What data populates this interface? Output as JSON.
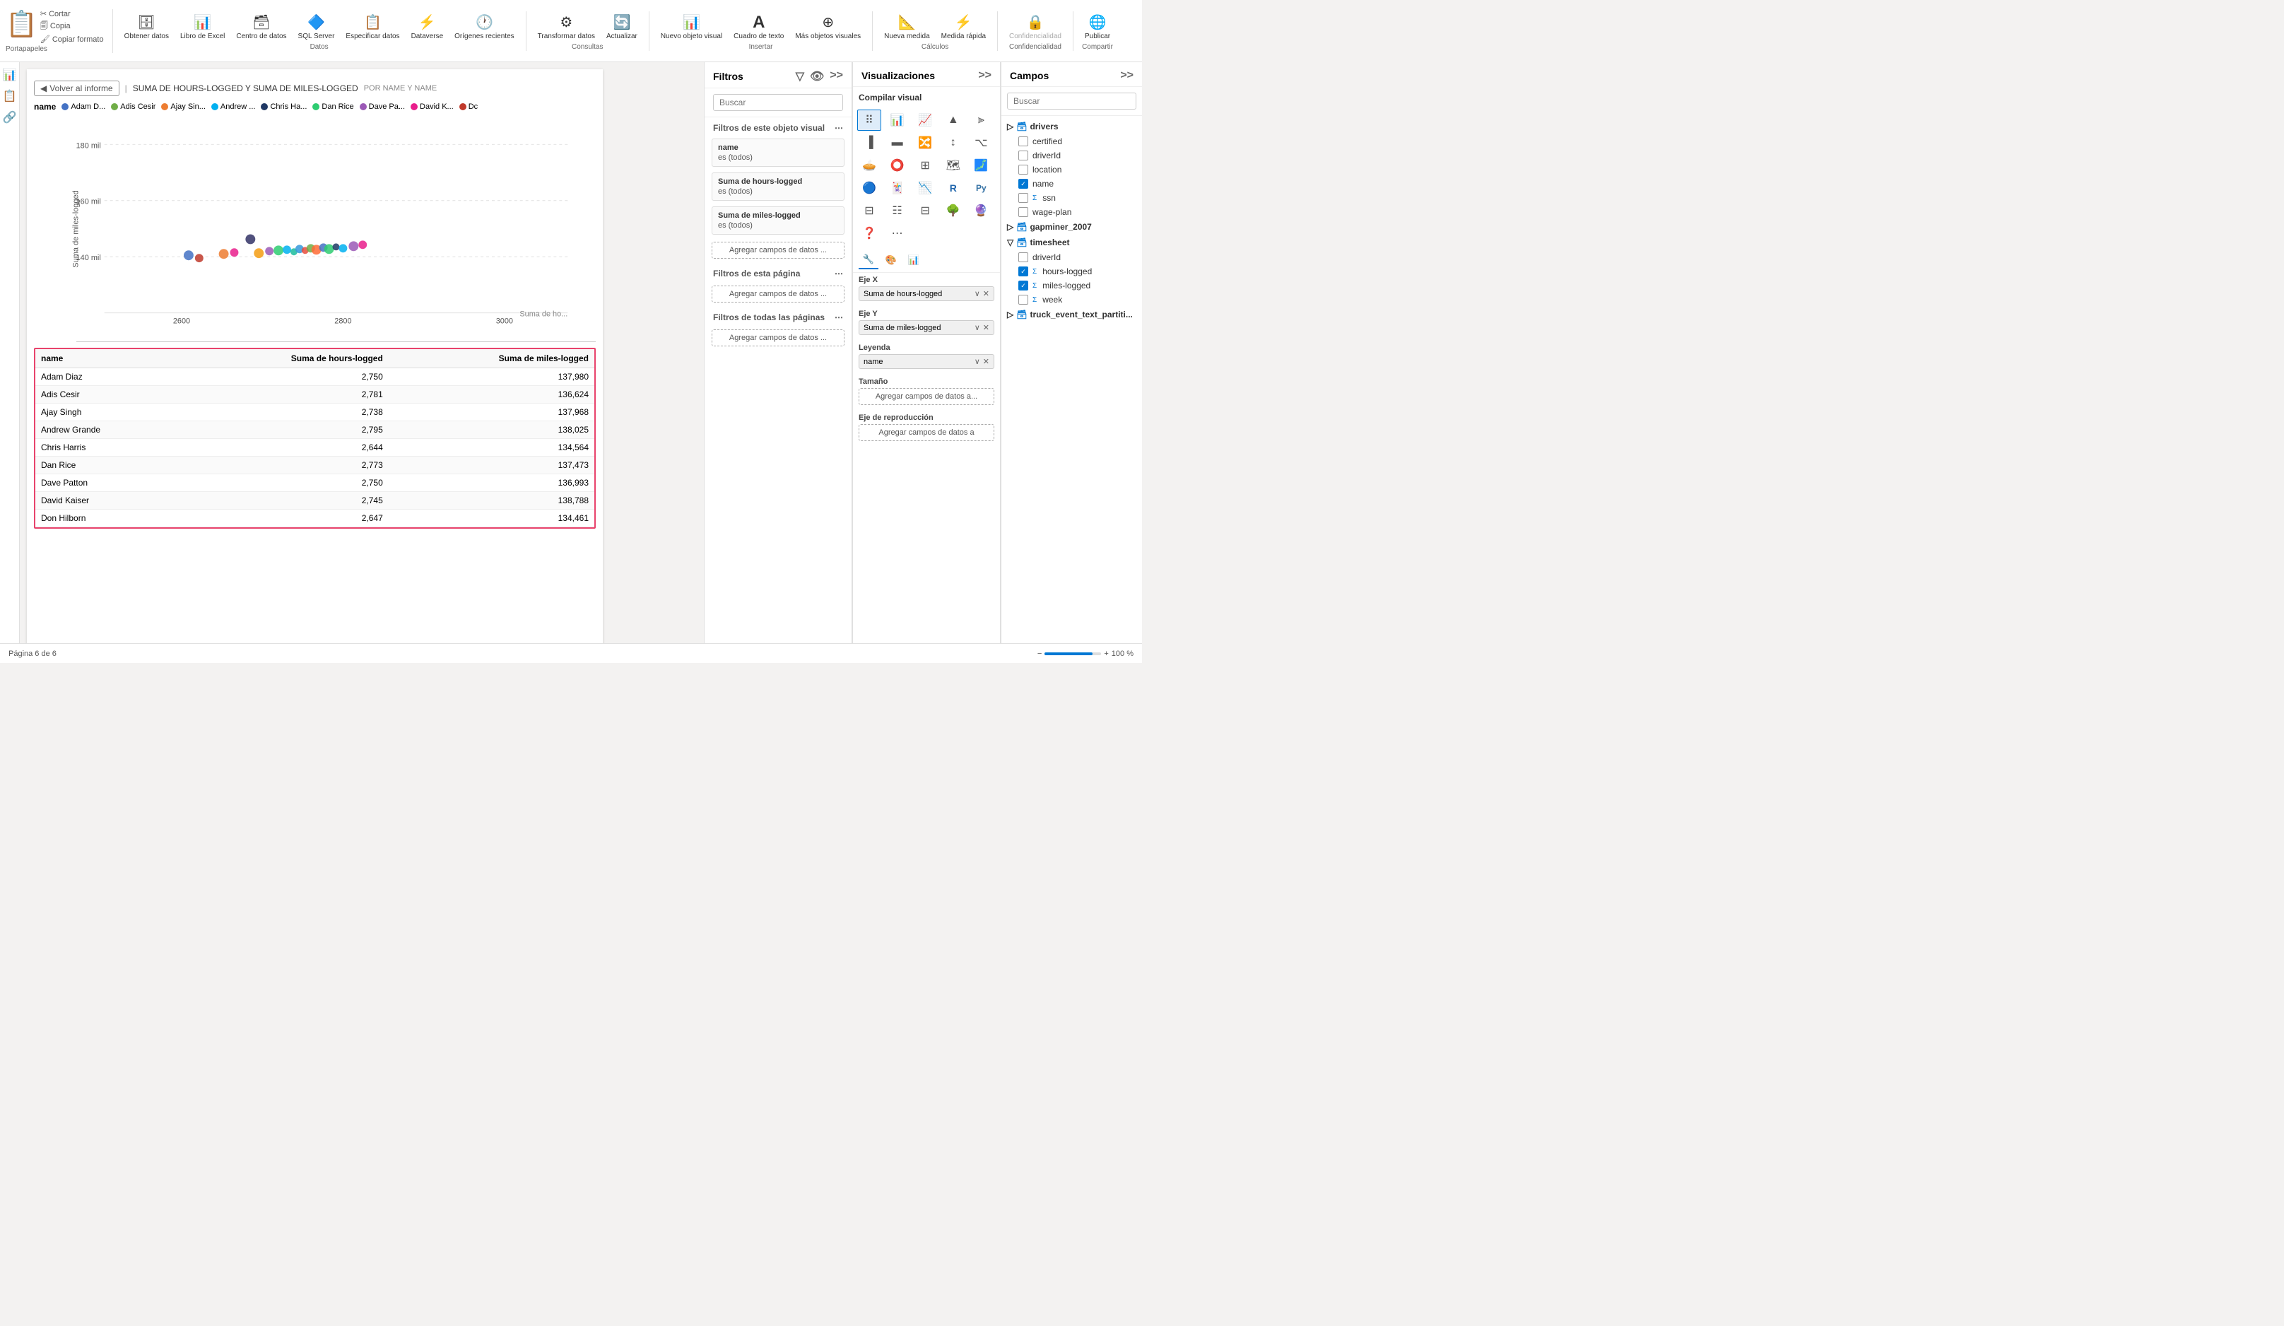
{
  "toolbar": {
    "groups": [
      {
        "id": "portapapeles",
        "label": "Portapapeles",
        "items": [
          {
            "id": "pegar",
            "label": "Pegar",
            "icon": "📋"
          },
          {
            "id": "cortar",
            "label": "Cortar",
            "icon": "✂"
          },
          {
            "id": "copia",
            "label": "Copia",
            "icon": "📄"
          },
          {
            "id": "copiar-formato",
            "label": "Copiar formato",
            "icon": "🖌"
          }
        ]
      },
      {
        "id": "datos",
        "label": "Datos",
        "items": [
          {
            "id": "obtener-datos",
            "label": "Obtener datos",
            "icon": "🗄"
          },
          {
            "id": "libro-excel",
            "label": "Libro de Excel",
            "icon": "📊"
          },
          {
            "id": "centro-datos",
            "label": "Centro de datos",
            "icon": "🗃"
          },
          {
            "id": "sql-server",
            "label": "SQL Server",
            "icon": "🔷"
          },
          {
            "id": "especificar-datos",
            "label": "Especificar datos",
            "icon": "📋"
          },
          {
            "id": "dataverse",
            "label": "Dataverse",
            "icon": "⚡"
          },
          {
            "id": "origenes-recientes",
            "label": "Orígenes recientes",
            "icon": "🕐"
          }
        ]
      },
      {
        "id": "consultas",
        "label": "Consultas",
        "items": [
          {
            "id": "transformar-datos",
            "label": "Transformar datos",
            "icon": "⚙"
          },
          {
            "id": "actualizar",
            "label": "Actualizar",
            "icon": "🔄"
          }
        ]
      },
      {
        "id": "insertar",
        "label": "Insertar",
        "items": [
          {
            "id": "nuevo-objeto-visual",
            "label": "Nuevo objeto visual",
            "icon": "📊"
          },
          {
            "id": "cuadro-texto",
            "label": "Cuadro de texto",
            "icon": "T"
          },
          {
            "id": "mas-objetos",
            "label": "Más objetos visuales",
            "icon": "⊕"
          }
        ]
      },
      {
        "id": "calculos",
        "label": "Cálculos",
        "items": [
          {
            "id": "nueva-medida",
            "label": "Nueva medida",
            "icon": "📐"
          },
          {
            "id": "medida-rapida",
            "label": "Medida rápida",
            "icon": "⚡"
          }
        ]
      },
      {
        "id": "confidencialidad",
        "label": "Confidencialidad",
        "items": [
          {
            "id": "confidencialidad-btn",
            "label": "Confidencialidad",
            "icon": "🔒"
          }
        ]
      },
      {
        "id": "compartir",
        "label": "Compartir",
        "items": [
          {
            "id": "publicar",
            "label": "Publicar",
            "icon": "🌐"
          }
        ]
      }
    ]
  },
  "breadcrumb": {
    "back_label": "Volver al informe",
    "title": "SUMA DE HOURS-LOGGED Y SUMA DE MILES-LOGGED",
    "subtitle": "POR NAME Y NAME"
  },
  "legend": {
    "name_label": "name",
    "items": [
      {
        "label": "Adam D...",
        "color": "#4472c4"
      },
      {
        "label": "Adis Cesir",
        "color": "#70ad47"
      },
      {
        "label": "Ajay Sin...",
        "color": "#ed7d31"
      },
      {
        "label": "Andrew ...",
        "color": "#00b0f0"
      },
      {
        "label": "Chris Ha...",
        "color": "#1f3864"
      },
      {
        "label": "Dan Rice",
        "color": "#2ecc71"
      },
      {
        "label": "Dave Pa...",
        "color": "#9b59b6"
      },
      {
        "label": "David K...",
        "color": "#e91e8c"
      },
      {
        "label": "Dc",
        "color": "#c0392b"
      }
    ]
  },
  "chart": {
    "y_axis_label": "Suma de miles-logged",
    "x_axis_label": "Suma de horas",
    "y_max": 180000,
    "y_mid": 160000,
    "y_min": 140000,
    "x_ticks": [
      "2600",
      "2800",
      "3000"
    ],
    "scatter_points": [
      {
        "x": 170,
        "y": 210,
        "color": "#4472c4",
        "r": 7
      },
      {
        "x": 200,
        "y": 225,
        "color": "#c0392b",
        "r": 6
      },
      {
        "x": 240,
        "y": 220,
        "color": "#e91e8c",
        "r": 7
      },
      {
        "x": 260,
        "y": 218,
        "color": "#e91e8c",
        "r": 5
      },
      {
        "x": 290,
        "y": 215,
        "color": "#ed7d31",
        "r": 7
      },
      {
        "x": 305,
        "y": 216,
        "color": "#f39c12",
        "r": 6
      },
      {
        "x": 315,
        "y": 214,
        "color": "#9b59b6",
        "r": 6
      },
      {
        "x": 325,
        "y": 210,
        "color": "#2ecc71",
        "r": 7
      },
      {
        "x": 335,
        "y": 207,
        "color": "#00b0f0",
        "r": 7
      },
      {
        "x": 340,
        "y": 212,
        "color": "#1abc9c",
        "r": 5
      },
      {
        "x": 350,
        "y": 209,
        "color": "#3498db",
        "r": 6
      },
      {
        "x": 355,
        "y": 213,
        "color": "#e74c3c",
        "r": 5
      },
      {
        "x": 360,
        "y": 208,
        "color": "#70ad47",
        "r": 6
      },
      {
        "x": 370,
        "y": 206,
        "color": "#ff6b35",
        "r": 7
      },
      {
        "x": 380,
        "y": 205,
        "color": "#4472c4",
        "r": 6
      },
      {
        "x": 390,
        "y": 207,
        "color": "#2ecc71",
        "r": 5
      },
      {
        "x": 400,
        "y": 204,
        "color": "#1f3864",
        "r": 6
      },
      {
        "x": 418,
        "y": 203,
        "color": "#00b0f0",
        "r": 7
      },
      {
        "x": 275,
        "y": 237,
        "color": "#333366",
        "r": 7
      },
      {
        "x": 430,
        "y": 200,
        "color": "#9b59b6",
        "r": 6
      },
      {
        "x": 440,
        "y": 201,
        "color": "#e91e8c",
        "r": 5
      }
    ],
    "x_label": "Suma de ho..."
  },
  "table": {
    "columns": [
      "name",
      "Suma de hours-logged",
      "Suma de miles-logged"
    ],
    "rows": [
      {
        "name": "Adam Diaz",
        "hours": 2750,
        "miles": 137980
      },
      {
        "name": "Adis Cesir",
        "hours": 2781,
        "miles": 136624
      },
      {
        "name": "Ajay Singh",
        "hours": 2738,
        "miles": 137968
      },
      {
        "name": "Andrew Grande",
        "hours": 2795,
        "miles": 138025
      },
      {
        "name": "Chris Harris",
        "hours": 2644,
        "miles": 134564
      },
      {
        "name": "Dan Rice",
        "hours": 2773,
        "miles": 137473
      },
      {
        "name": "Dave Patton",
        "hours": 2750,
        "miles": 136993
      },
      {
        "name": "David Kaiser",
        "hours": 2745,
        "miles": 138788
      },
      {
        "name": "Don Hilborn",
        "hours": 2647,
        "miles": 134461
      }
    ]
  },
  "filters": {
    "panel_title": "Filtros",
    "search_placeholder": "Buscar",
    "section_visual": "Filtros de este objeto visual",
    "filter_name": {
      "field": "name",
      "value": "es (todos)"
    },
    "filter_hours": {
      "field": "Suma de hours-logged",
      "value": "es (todos)"
    },
    "filter_miles": {
      "field": "Suma de miles-logged",
      "value": "es (todos)"
    },
    "section_page": "Filtros de esta página",
    "section_all": "Filtros de todas las páginas",
    "add_fields": "Agregar campos de datos ..."
  },
  "visualizations": {
    "panel_title": "Visualizaciones",
    "compile_label": "Compilar visual",
    "eje_x": {
      "label": "Eje X",
      "value": "Suma de hours-logged"
    },
    "eje_y": {
      "label": "Eje Y",
      "value": "Suma de miles-logged"
    },
    "leyenda": {
      "label": "Leyenda",
      "value": "name"
    },
    "tamaño": {
      "label": "Tamaño",
      "placeholder": "Agregar campos de datos a..."
    },
    "eje_reproduccion": {
      "label": "Eje de reproducción",
      "placeholder": "Agregar campos de datos a"
    }
  },
  "fields": {
    "panel_title": "Campos",
    "search_placeholder": "Buscar",
    "groups": [
      {
        "id": "drivers",
        "label": "drivers",
        "icon": "🗃",
        "items": [
          {
            "label": "certified",
            "checked": false,
            "type": "field"
          },
          {
            "label": "driverId",
            "checked": false,
            "type": "field"
          },
          {
            "label": "location",
            "checked": false,
            "type": "field"
          },
          {
            "label": "name",
            "checked": true,
            "type": "field"
          },
          {
            "label": "ssn",
            "checked": false,
            "type": "field"
          },
          {
            "label": "wage-plan",
            "checked": false,
            "type": "field"
          }
        ]
      },
      {
        "id": "gapminer_2007",
        "label": "gapminer_2007",
        "icon": "🗃",
        "items": []
      },
      {
        "id": "timesheet",
        "label": "timesheet",
        "icon": "🗃",
        "items": [
          {
            "label": "driverId",
            "checked": false,
            "type": "field"
          },
          {
            "label": "hours-logged",
            "checked": true,
            "type": "sigma"
          },
          {
            "label": "miles-logged",
            "checked": true,
            "type": "sigma"
          },
          {
            "label": "week",
            "checked": false,
            "type": "sigma"
          }
        ]
      },
      {
        "id": "truck_event",
        "label": "truck_event_text_partiti...",
        "icon": "🗃",
        "items": []
      }
    ]
  },
  "statusbar": {
    "page_label": "Página 6 de 6",
    "zoom_label": "100 %"
  }
}
